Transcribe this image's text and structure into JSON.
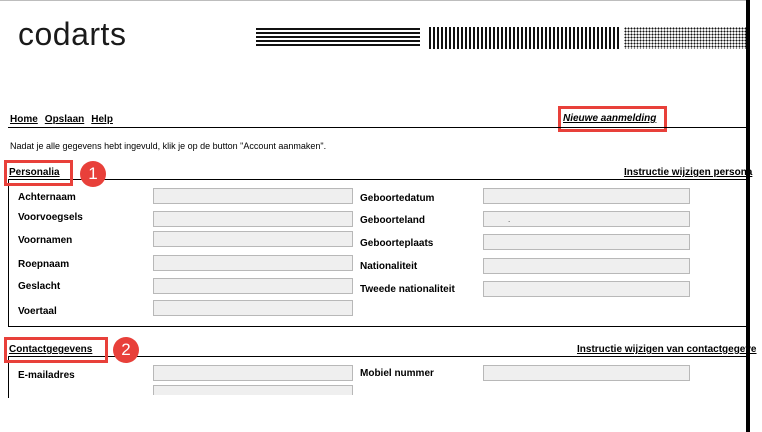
{
  "header": {
    "logo": "codarts"
  },
  "nav": {
    "items": [
      "Home",
      "Opslaan",
      "Help"
    ],
    "status": "Nieuwe aanmelding"
  },
  "intro": "Nadat je alle gegevens hebt ingevuld, klik je op de button \"Account aanmaken\".",
  "personalia": {
    "title": "Personalia",
    "badge": "1",
    "instruction_link": "Instructie wijzigen persona",
    "left_labels": [
      "Achternaam",
      "Voorvoegsels",
      "Voornamen",
      "Roepnaam",
      "Geslacht",
      "Voertaal"
    ],
    "right_labels": [
      "Geboortedatum",
      "Geboorteland",
      "Geboorteplaats",
      "Nationaliteit",
      "Tweede nationaliteit"
    ],
    "geboorteland_value": "."
  },
  "contact": {
    "title": "Contactgegevens",
    "badge": "2",
    "instruction_link": "Instructie wijzigen van contactgegeve",
    "left_labels": [
      "E-mailadres"
    ],
    "right_labels": [
      "Mobiel nummer"
    ]
  },
  "colors": {
    "highlight": "#e8403a",
    "field_bg": "#efefef"
  }
}
